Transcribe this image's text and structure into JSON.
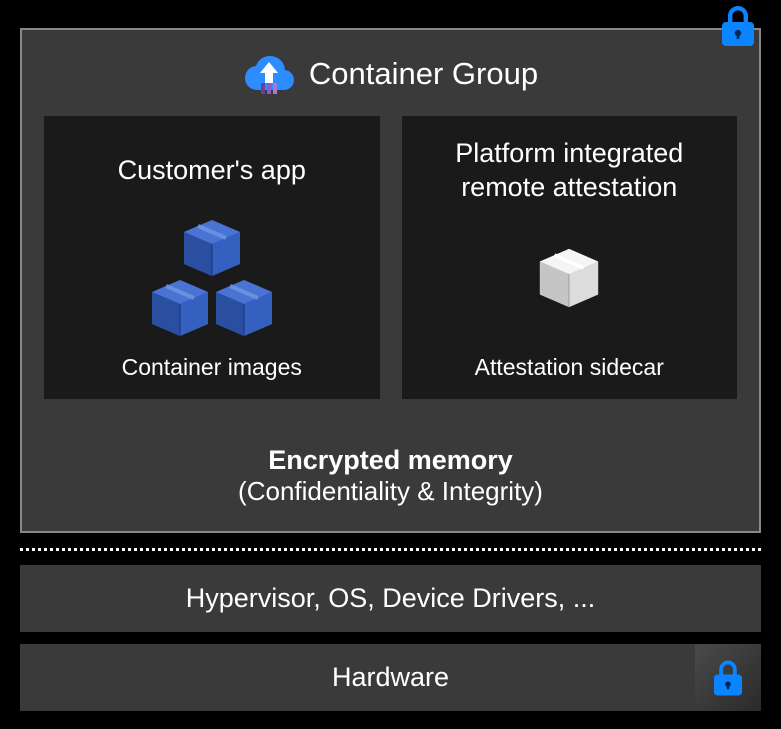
{
  "containerGroup": {
    "title": "Container Group",
    "cards": [
      {
        "title": "Customer's app",
        "caption": "Container images"
      },
      {
        "title": "Platform integrated remote attestation",
        "caption": "Attestation sidecar"
      }
    ],
    "encryptedMemory": {
      "title": "Encrypted memory",
      "subtitle": "(Confidentiality & Integrity)"
    }
  },
  "layers": [
    "Hypervisor, OS, Device Drivers, ...",
    "Hardware"
  ],
  "icons": {
    "lock": "lock-icon",
    "cloudUpload": "cloud-upload-icon",
    "boxBlue": "box-blue-icon",
    "boxWhite": "box-white-icon"
  },
  "colors": {
    "lockBlue": "#0a84ff",
    "boxBlue": "#3b6fd8",
    "cardBg": "#1a1a1a",
    "panelBg": "#3a3a3a"
  }
}
